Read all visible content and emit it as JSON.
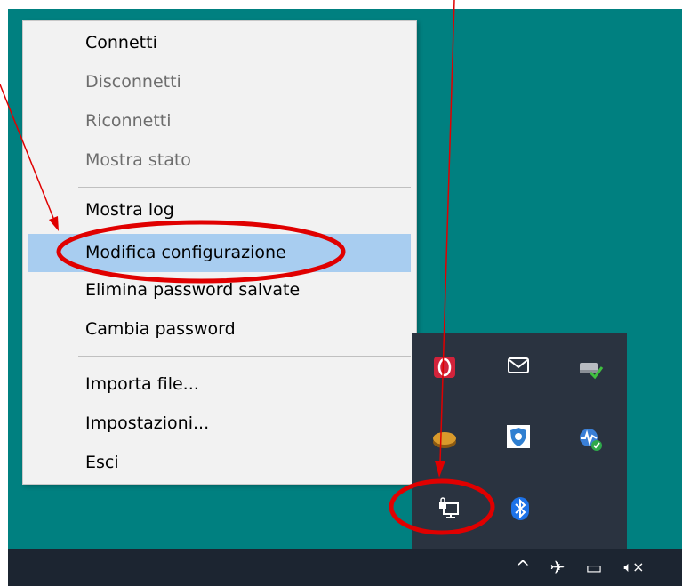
{
  "context_menu": {
    "items": [
      {
        "label": "Connetti",
        "state": "enabled"
      },
      {
        "label": "Disconnetti",
        "state": "disabled"
      },
      {
        "label": "Riconnetti",
        "state": "disabled"
      },
      {
        "label": "Mostra stato",
        "state": "disabled"
      },
      {
        "label": "Mostra log",
        "state": "enabled"
      },
      {
        "label": "Modifica configurazione",
        "state": "highlighted"
      },
      {
        "label": "Elimina password salvate",
        "state": "enabled"
      },
      {
        "label": "Cambia password",
        "state": "enabled"
      },
      {
        "label": "Importa file...",
        "state": "enabled"
      },
      {
        "label": "Impostazioni...",
        "state": "enabled"
      },
      {
        "label": "Esci",
        "state": "enabled"
      }
    ]
  },
  "tray_flyout": {
    "icons": [
      "antivirus-shield-icon",
      "mail-icon",
      "network-drive-check-icon",
      "disk-tool-icon",
      "security-shield-icon",
      "network-monitor-icon",
      "vpn-computer-lock-icon",
      "bluetooth-icon"
    ]
  },
  "taskbar": {
    "icons": [
      "chevron-up-icon",
      "airplane-mode-icon",
      "battery-icon",
      "volume-muted-icon"
    ],
    "glyphs": {
      "chevron": "^",
      "airplane": "✈",
      "battery": "▭",
      "volume": "🔈︎×"
    }
  },
  "colors": {
    "desktop": "#008080",
    "taskbar": "#1c2531",
    "tray_flyout": "#2a3340",
    "menu_background": "#f2f2f2",
    "menu_highlight": "#a8cdf0",
    "annotation": "#e00000"
  }
}
